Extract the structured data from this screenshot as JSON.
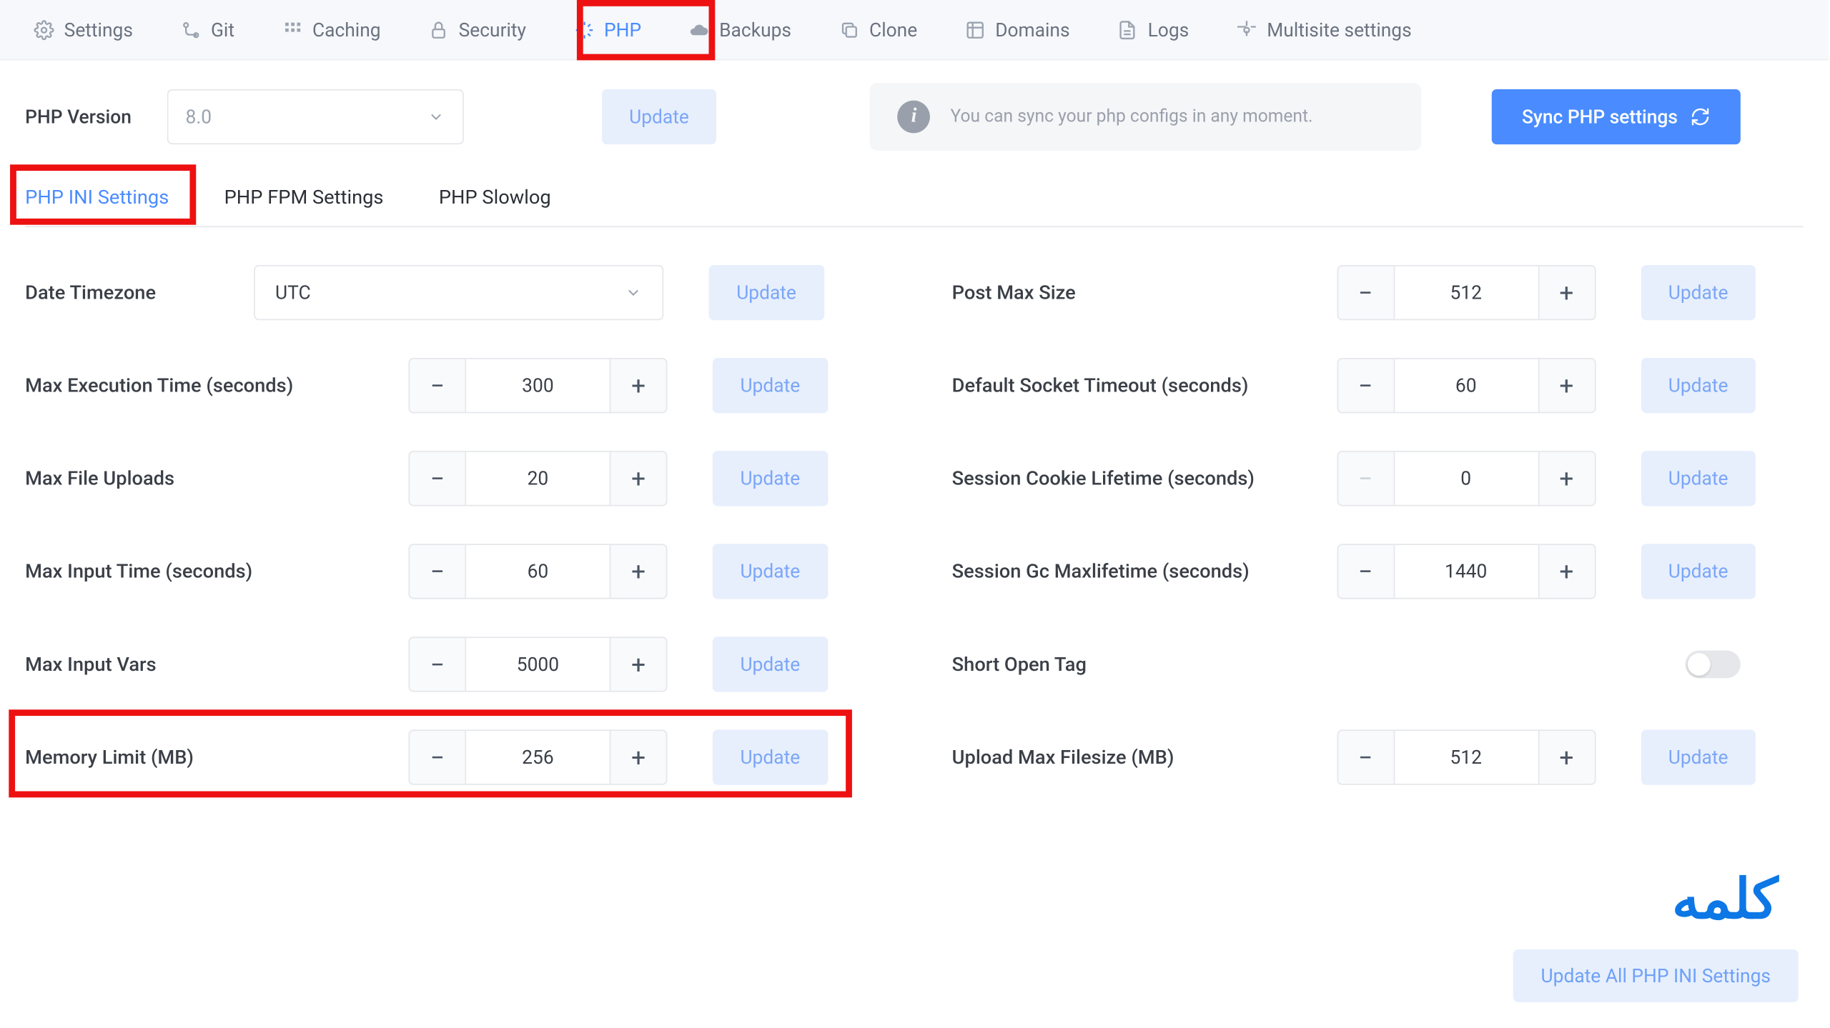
{
  "topnav": [
    {
      "label": "Settings",
      "icon": "gear"
    },
    {
      "label": "Git",
      "icon": "git"
    },
    {
      "label": "Caching",
      "icon": "cache"
    },
    {
      "label": "Security",
      "icon": "lock"
    },
    {
      "label": "PHP",
      "icon": "php"
    },
    {
      "label": "Backups",
      "icon": "cloud"
    },
    {
      "label": "Clone",
      "icon": "clone"
    },
    {
      "label": "Domains",
      "icon": "domains"
    },
    {
      "label": "Logs",
      "icon": "logs"
    },
    {
      "label": "Multisite settings",
      "icon": "multisite"
    }
  ],
  "active_top_tab": "PHP",
  "php_version_label": "PHP Version",
  "php_version_value": "8.0",
  "info_text": "You can sync your php configs in any moment.",
  "sync_btn": "Sync PHP settings",
  "update_btn": "Update",
  "subtabs": [
    "PHP INI Settings",
    "PHP FPM Settings",
    "PHP Slowlog"
  ],
  "active_subtab": "PHP INI Settings",
  "date_timezone_label": "Date Timezone",
  "date_timezone_value": "UTC",
  "left_rows": [
    {
      "label": "Max Execution Time (seconds)",
      "value": "300"
    },
    {
      "label": "Max File Uploads",
      "value": "20"
    },
    {
      "label": "Max Input Time (seconds)",
      "value": "60"
    },
    {
      "label": "Max Input Vars",
      "value": "5000"
    },
    {
      "label": "Memory Limit (MB)",
      "value": "256"
    }
  ],
  "right_rows": [
    {
      "label": "Post Max Size",
      "value": "512",
      "disabled_minus": false
    },
    {
      "label": "Default Socket Timeout (seconds)",
      "value": "60",
      "disabled_minus": false
    },
    {
      "label": "Session Cookie Lifetime (seconds)",
      "value": "0",
      "disabled_minus": true
    },
    {
      "label": "Session Gc Maxlifetime (seconds)",
      "value": "1440",
      "disabled_minus": false
    }
  ],
  "short_open_tag_label": "Short Open Tag",
  "upload_max_label": "Upload Max Filesize (MB)",
  "upload_max_value": "512",
  "update_all": "Update All PHP INI Settings",
  "logo": "كلمه"
}
